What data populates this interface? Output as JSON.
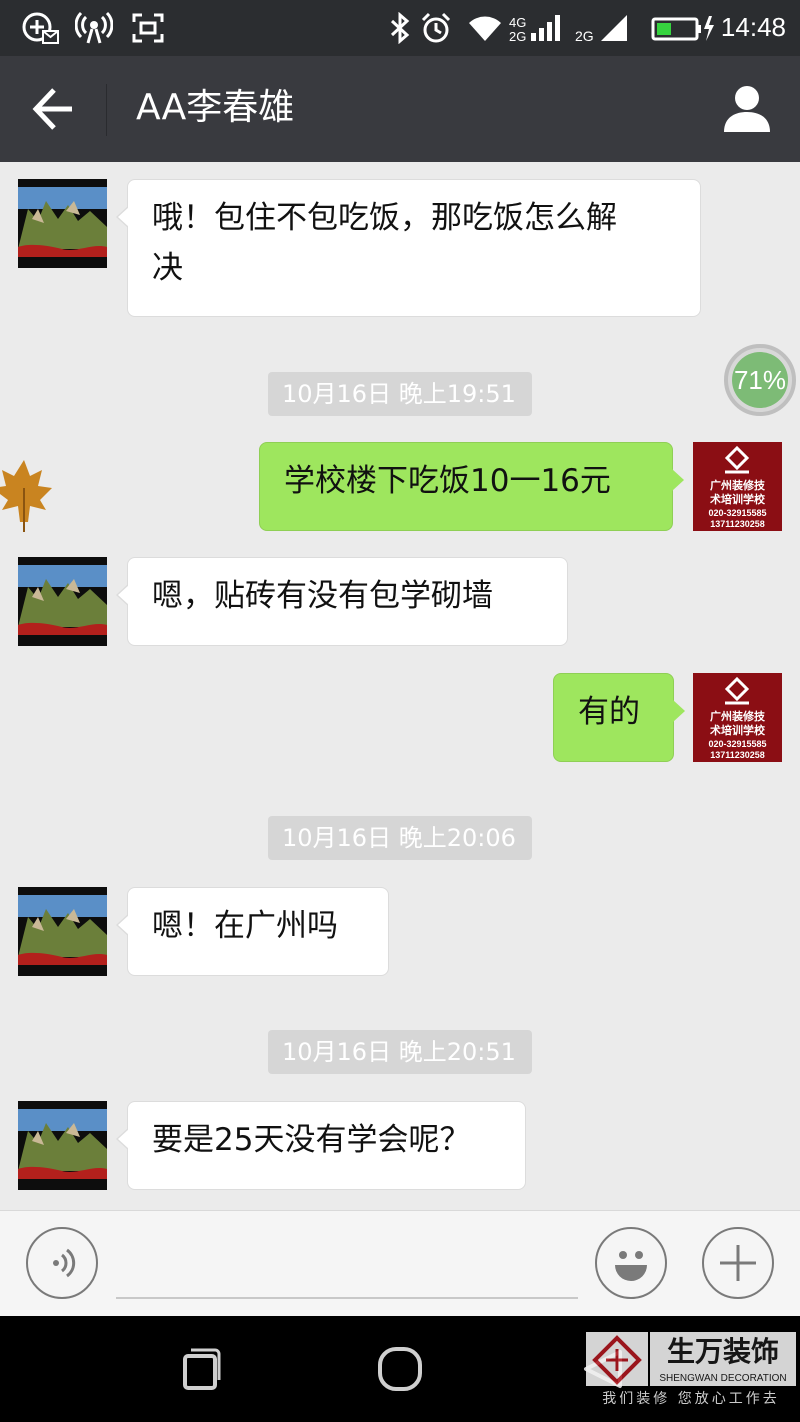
{
  "status_bar": {
    "time": "14:48",
    "network_label": "2G",
    "icons": [
      "app-notification-icon",
      "hotspot-icon",
      "screenshot-icon",
      "bluetooth-icon",
      "alarm-icon",
      "wifi-icon",
      "signal-4g-icon",
      "signal-2g-icon",
      "battery-charging-icon"
    ]
  },
  "header": {
    "title": "AA李春雄",
    "back_icon": "back-arrow-icon",
    "profile_icon": "person-icon"
  },
  "messages": [
    {
      "type": "incoming",
      "text_line1": "哦！包住不包吃饭，那吃饭怎么解",
      "text_line2": "决"
    },
    {
      "type": "timestamp",
      "text": "10月16日 晚上19:51"
    },
    {
      "type": "outgoing",
      "text": "学校楼下吃饭10一16元"
    },
    {
      "type": "incoming",
      "text": "嗯，贴砖有没有包学砌墙"
    },
    {
      "type": "outgoing",
      "text": "有的"
    },
    {
      "type": "timestamp",
      "text": "10月16日 晚上20:06"
    },
    {
      "type": "incoming",
      "text": "嗯！在广州吗"
    },
    {
      "type": "timestamp",
      "text": "10月16日 晚上20:51"
    },
    {
      "type": "incoming",
      "text": "要是25天没有学会呢？"
    }
  ],
  "sender_avatar": {
    "line1": "广州装修技",
    "line2": "术培训学校",
    "phone1": "020-32915585",
    "phone2": "13711230258"
  },
  "floating_badge": {
    "text": "71%"
  },
  "input_bar": {
    "voice_icon": "voice-icon",
    "emoji_icon": "emoji-icon",
    "plus_icon": "plus-icon"
  },
  "nav_bar": {
    "icons": [
      "back-triangle-icon",
      "home-circle-icon",
      "recents-square-icon"
    ]
  },
  "watermark": {
    "title": "生万装饰",
    "subtitle": "SHENGWAN DECORATION",
    "slogan": "我们装修 您放心工作去"
  },
  "colors": {
    "header_bg": "#393a3f",
    "chat_bg": "#ebebeb",
    "outgoing_bubble": "#9ee65e",
    "incoming_bubble": "#ffffff",
    "timestamp_bg": "#d6d6d6"
  }
}
